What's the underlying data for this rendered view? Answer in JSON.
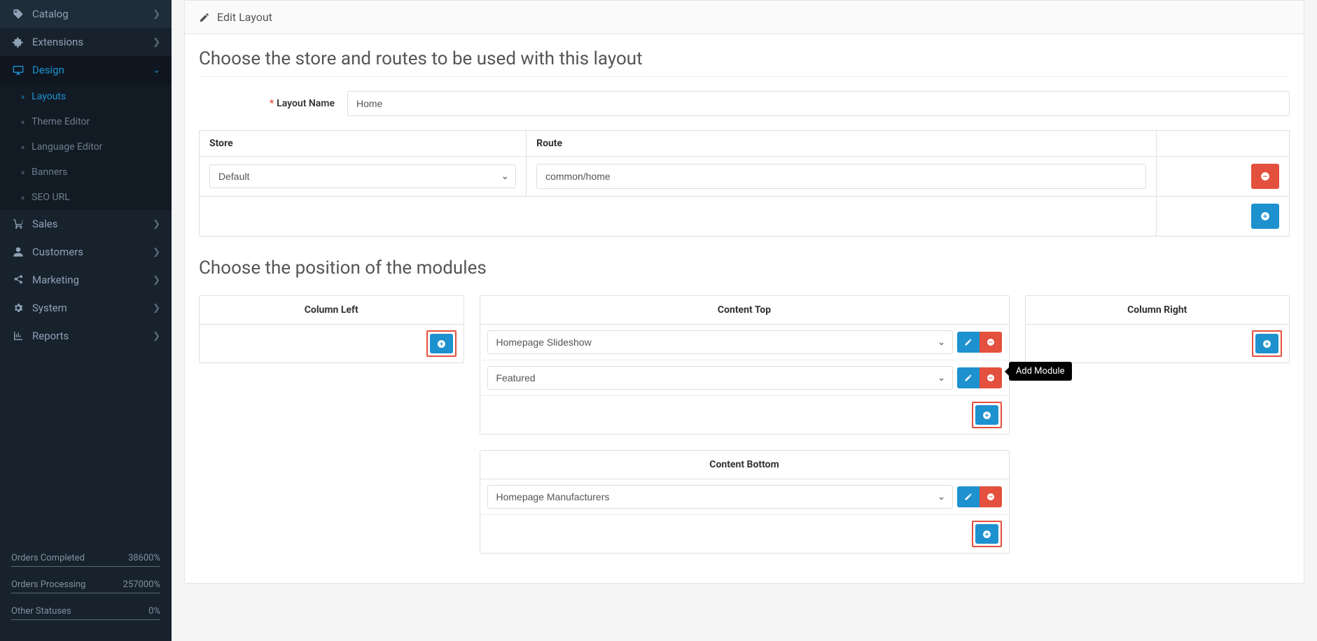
{
  "sidebar": {
    "items": [
      {
        "label": "Catalog",
        "icon": "tag",
        "expandable": true
      },
      {
        "label": "Extensions",
        "icon": "plugin",
        "expandable": true
      },
      {
        "label": "Design",
        "icon": "monitor",
        "expandable": true,
        "active": true,
        "children": [
          {
            "label": "Layouts",
            "active": true
          },
          {
            "label": "Theme Editor"
          },
          {
            "label": "Language Editor"
          },
          {
            "label": "Banners"
          },
          {
            "label": "SEO URL"
          }
        ]
      },
      {
        "label": "Sales",
        "icon": "cart",
        "expandable": true
      },
      {
        "label": "Customers",
        "icon": "user",
        "expandable": true
      },
      {
        "label": "Marketing",
        "icon": "share",
        "expandable": true
      },
      {
        "label": "System",
        "icon": "gear",
        "expandable": true
      },
      {
        "label": "Reports",
        "icon": "chart",
        "expandable": true
      }
    ],
    "stats": [
      {
        "label": "Orders Completed",
        "value": "38600%"
      },
      {
        "label": "Orders Processing",
        "value": "257000%"
      },
      {
        "label": "Other Statuses",
        "value": "0%"
      }
    ]
  },
  "panel": {
    "heading": "Edit Layout",
    "section1_title": "Choose the store and routes to be used with this layout",
    "layout_name_label": "Layout Name",
    "layout_name_value": "Home",
    "routes_table": {
      "headers": {
        "store": "Store",
        "route": "Route"
      },
      "rows": [
        {
          "store": "Default",
          "route": "common/home"
        }
      ]
    },
    "section2_title": "Choose the position of the modules",
    "positions": {
      "column_left": {
        "title": "Column Left",
        "modules": []
      },
      "content_top": {
        "title": "Content Top",
        "modules": [
          "Homepage Slideshow",
          "Featured"
        ]
      },
      "content_bottom": {
        "title": "Content Bottom",
        "modules": [
          "Homepage Manufacturers"
        ]
      },
      "column_right": {
        "title": "Column Right",
        "modules": []
      }
    },
    "tooltip_add_module": "Add Module"
  },
  "colors": {
    "primary": "#1e91cf",
    "danger": "#e3503e",
    "sidebar_bg": "#18222d"
  }
}
